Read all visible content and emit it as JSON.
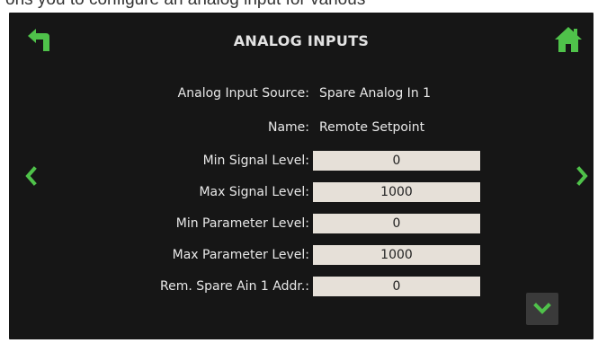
{
  "doc_text": "ons you to configure an analog input for various",
  "screen": {
    "title": "ANALOG INPUTS",
    "icons": {
      "back": "back-arrow-icon",
      "home": "home-icon",
      "left": "chevron-left-icon",
      "right": "chevron-right-icon",
      "down": "chevron-down-icon"
    },
    "accent_color": "#4fc24a",
    "rows": [
      {
        "label": "Analog Input Source:",
        "value": "Spare Analog In 1"
      },
      {
        "label": "Name:",
        "value": "Remote Setpoint"
      },
      {
        "label": "Min Signal Level:",
        "value": "0"
      },
      {
        "label": "Max Signal Level:",
        "value": "1000"
      },
      {
        "label": "Min Parameter Level:",
        "value": "0"
      },
      {
        "label": "Max Parameter Level:",
        "value": "1000"
      },
      {
        "label": "Rem. Spare Ain 1 Addr.:",
        "value": "0"
      }
    ]
  }
}
